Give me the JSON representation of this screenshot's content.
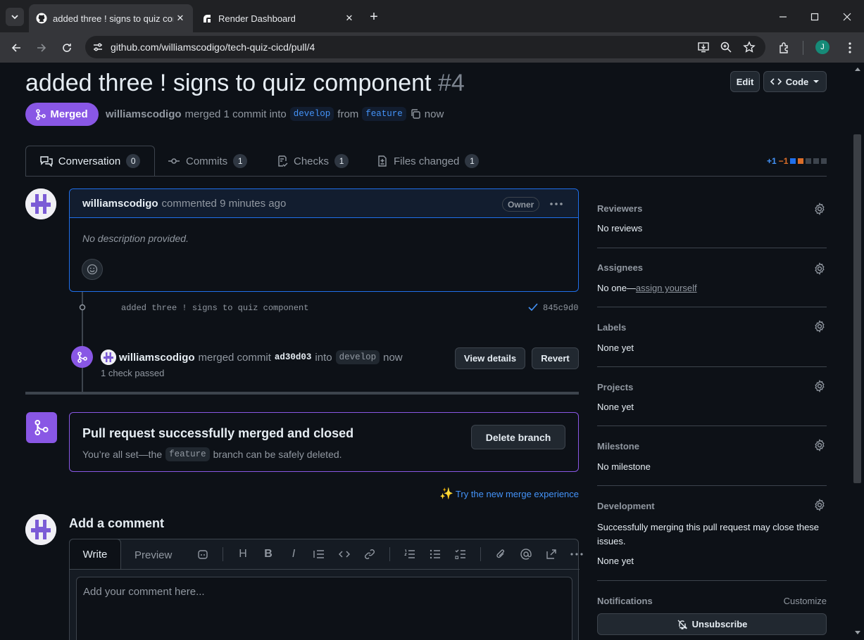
{
  "browser": {
    "tabs": [
      {
        "title": "added three ! signs to quiz com",
        "icon": "github-icon",
        "active": true
      },
      {
        "title": "Render Dashboard",
        "icon": "render-icon",
        "active": false
      }
    ],
    "url": "github.com/williamscodigo/tech-quiz-cicd/pull/4",
    "profile_initial": "J"
  },
  "pr": {
    "title": "added three ! signs to quiz component",
    "number": "#4",
    "edit_label": "Edit",
    "code_label": "Code",
    "state_label": "Merged",
    "author": "williamscodigo",
    "merged_text": "merged 1 commit into",
    "base_branch": "develop",
    "from_text": "from",
    "head_branch": "feature",
    "time": "now"
  },
  "tabs": [
    {
      "label": "Conversation",
      "count": "0"
    },
    {
      "label": "Commits",
      "count": "1"
    },
    {
      "label": "Checks",
      "count": "1"
    },
    {
      "label": "Files changed",
      "count": "1"
    }
  ],
  "diffstat": {
    "additions": "+1",
    "deletions": "−1"
  },
  "comment": {
    "author": "williamscodigo",
    "action": "commented 9 minutes ago",
    "badge": "Owner",
    "body": "No description provided."
  },
  "commit": {
    "message": "added three ! signs to quiz component",
    "sha": "845c9d0"
  },
  "merge_event": {
    "author": "williamscodigo",
    "action": "merged commit",
    "sha": "ad30d03",
    "into_text": "into",
    "branch": "develop",
    "time": "now",
    "checks": "1 check passed",
    "view_details_label": "View details",
    "revert_label": "Revert"
  },
  "merged_box": {
    "title": "Pull request successfully merged and closed",
    "text_before": "You’re all set—the",
    "branch": "feature",
    "text_after": "branch can be safely deleted.",
    "delete_label": "Delete branch"
  },
  "new_merge_link": "Try the new merge experience",
  "add_comment": {
    "heading": "Add a comment",
    "write_tab": "Write",
    "preview_tab": "Preview",
    "placeholder": "Add your comment here..."
  },
  "sidebar": {
    "reviewers": {
      "heading": "Reviewers",
      "value": "No reviews"
    },
    "assignees": {
      "heading": "Assignees",
      "value": "No one—",
      "link": "assign yourself"
    },
    "labels": {
      "heading": "Labels",
      "value": "None yet"
    },
    "projects": {
      "heading": "Projects",
      "value": "None yet"
    },
    "milestone": {
      "heading": "Milestone",
      "value": "No milestone"
    },
    "development": {
      "heading": "Development",
      "text": "Successfully merging this pull request may close these issues.",
      "value": "None yet"
    },
    "notifications": {
      "heading": "Notifications",
      "customize": "Customize",
      "unsubscribe": "Unsubscribe"
    }
  },
  "colors": {
    "accent_purple": "#8957e5",
    "link_blue": "#4493f8",
    "bg": "#0d1117",
    "border": "#3d444d"
  }
}
